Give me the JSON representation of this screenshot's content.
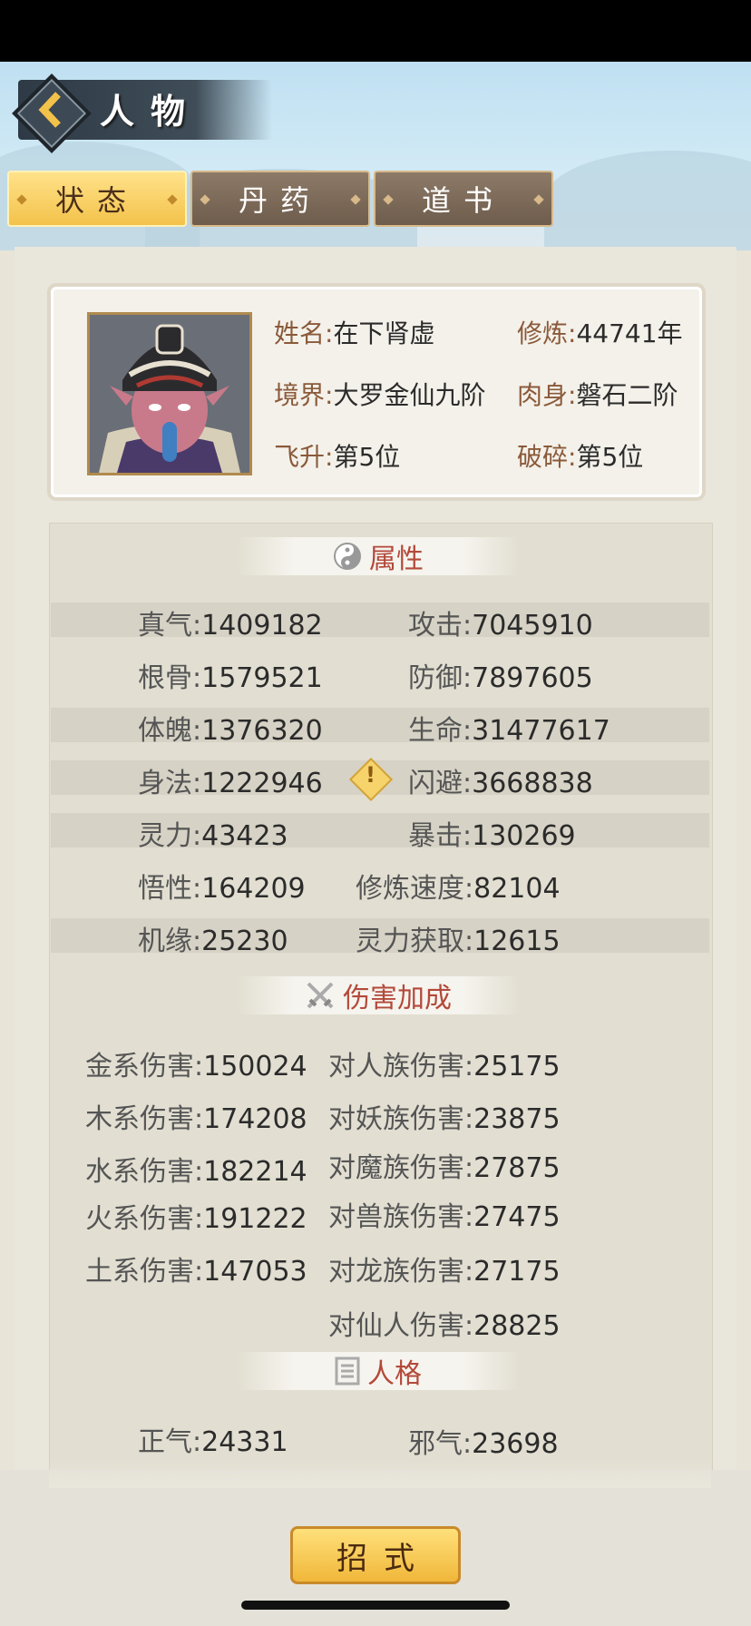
{
  "header": {
    "title": "人物"
  },
  "tabs": [
    {
      "label": "状态",
      "active": true
    },
    {
      "label": "丹药",
      "active": false
    },
    {
      "label": "道书",
      "active": false
    }
  ],
  "profile": {
    "name_label": "姓名:",
    "name": "在下肾虚",
    "cultivation_label": "修炼:",
    "cultivation": "44741年",
    "realm_label": "境界:",
    "realm": "大罗金仙九阶",
    "body_label": "肉身:",
    "body": "磐石二阶",
    "ascend_label": "飞升:",
    "ascend": "第5位",
    "shatter_label": "破碎:",
    "shatter": "第5位"
  },
  "sections": {
    "attributes": {
      "title": "属性",
      "icon": "yin-yang-icon"
    },
    "damage": {
      "title": "伤害加成",
      "icon": "crossed-swords-icon"
    },
    "personality": {
      "title": "人格",
      "icon": "book-icon"
    }
  },
  "attributes": [
    {
      "left_k": "真气:",
      "left_v": "1409182",
      "right_k": "攻击:",
      "right_v": "7045910"
    },
    {
      "left_k": "根骨:",
      "left_v": "1579521",
      "right_k": "防御:",
      "right_v": "7897605"
    },
    {
      "left_k": "体魄:",
      "left_v": "1376320",
      "right_k": "生命:",
      "right_v": "31477617"
    },
    {
      "left_k": "身法:",
      "left_v": "1222946",
      "right_k": "闪避:",
      "right_v": "3668838"
    },
    {
      "left_k": "灵力:",
      "left_v": "43423",
      "right_k": "暴击:",
      "right_v": "130269"
    },
    {
      "left_k": "悟性:",
      "left_v": "164209",
      "right_k": "修炼速度:",
      "right_v": "82104"
    },
    {
      "left_k": "机缘:",
      "left_v": "25230",
      "right_k": "灵力获取:",
      "right_v": "12615"
    }
  ],
  "damage": [
    {
      "left_k": "金系伤害:",
      "left_v": "150024",
      "right_k": "对人族伤害:",
      "right_v": "25175"
    },
    {
      "left_k": "木系伤害:",
      "left_v": "174208",
      "right_k": "对妖族伤害:",
      "right_v": "23875"
    },
    {
      "left_k": "水系伤害:",
      "left_v": "182214",
      "right_k": "对魔族伤害:",
      "right_v": "27875"
    },
    {
      "left_k": "火系伤害:",
      "left_v": "191222",
      "right_k": "对兽族伤害:",
      "right_v": "27475"
    },
    {
      "left_k": "土系伤害:",
      "left_v": "147053",
      "right_k": "对龙族伤害:",
      "right_v": "27175"
    },
    {
      "left_k": "",
      "left_v": "",
      "right_k": "对仙人伤害:",
      "right_v": "28825"
    }
  ],
  "personality": [
    {
      "left_k": "正气:",
      "left_v": "24331",
      "right_k": "邪气:",
      "right_v": "23698"
    }
  ],
  "warning_icon_glyph": "!",
  "skill_button": {
    "label": "招式"
  }
}
